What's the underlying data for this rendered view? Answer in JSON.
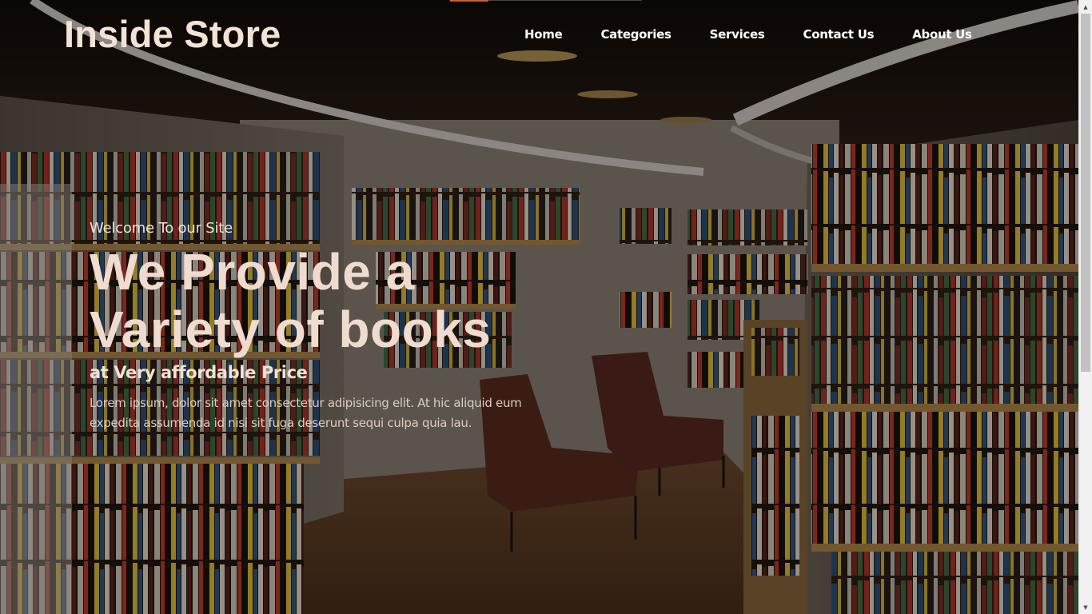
{
  "brand": {
    "name": "Inside Store"
  },
  "nav": {
    "items": [
      {
        "label": "Home"
      },
      {
        "label": "Categories"
      },
      {
        "label": "Services"
      },
      {
        "label": "Contact Us"
      },
      {
        "label": "About Us"
      }
    ]
  },
  "hero": {
    "welcome": "Welcome To our Site",
    "headline_line1": "We Provide a",
    "headline_line2": "Variety of books",
    "subheading": "at Very affordable Price",
    "description": "Lorem ipsum, dolor sit amet consectetur adipisicing elit. At hic aliquid eum expedita assumenda id nisi sit fuga deserunt sequi culpa quia lau."
  },
  "icons": {
    "scroll_up": "scroll-up-arrow-icon",
    "scroll_down": "scroll-down-arrow-icon"
  },
  "colors": {
    "accent": "#c8602e",
    "heading_text": "#efdccf",
    "nav_text": "#ffffff"
  },
  "scroll": {
    "thumb_fraction": 0.61,
    "position_fraction": 0.0
  }
}
